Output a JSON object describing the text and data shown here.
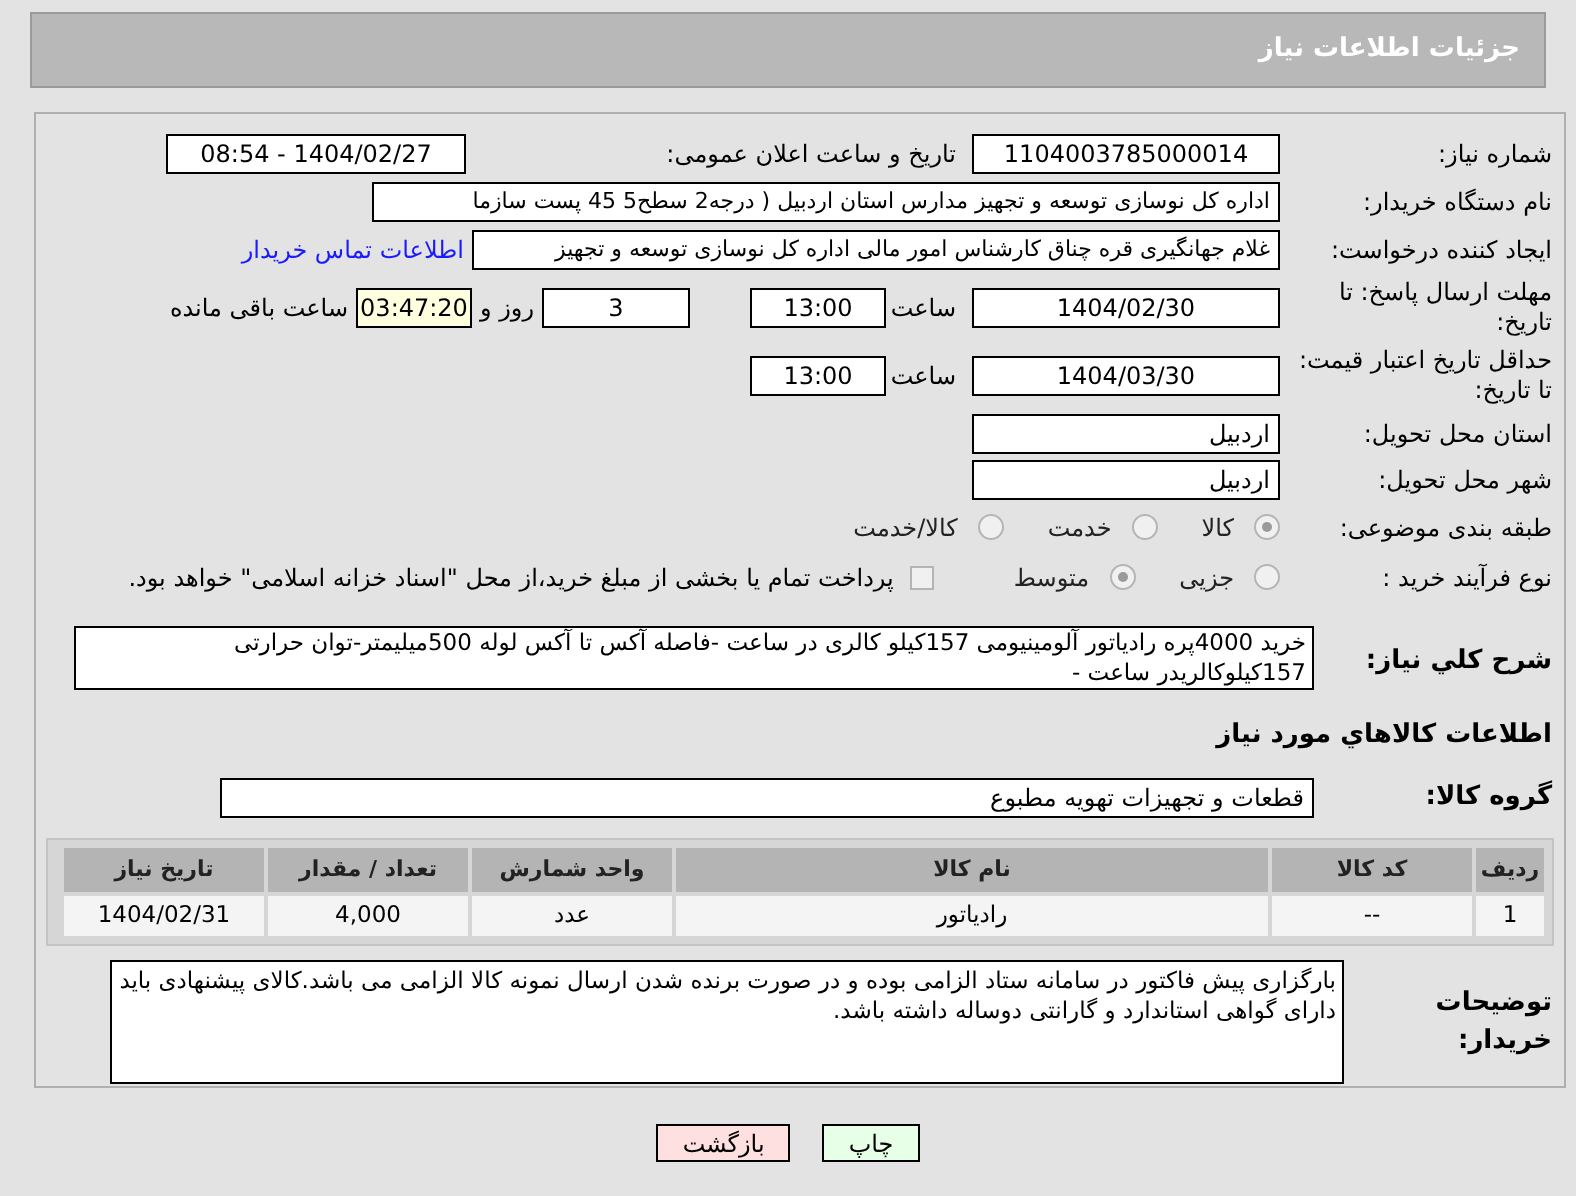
{
  "header": {
    "title": "جزئیات اطلاعات نیاز"
  },
  "need_number": {
    "label": "شماره نیاز:",
    "value": "1104003785000014"
  },
  "announce": {
    "label": "تاریخ و ساعت اعلان عمومی:",
    "value": "1404/02/27 - 08:54"
  },
  "buyer": {
    "label": "نام دستگاه خریدار:",
    "value": "اداره کل نوسازی   توسعه و تجهیز مدارس استان اردبیل ( درجه2  سطح5  45 پست سازما"
  },
  "creator": {
    "label": "ایجاد کننده درخواست:",
    "value": "غلام جهانگیری قره چناق کارشناس امور مالی اداره کل نوسازی   توسعه و تجهیز",
    "link": "اطلاعات تماس خریدار"
  },
  "deadline": {
    "label": "مهلت ارسال پاسخ: تا تاریخ:",
    "date": "1404/02/30",
    "time_label": "ساعت",
    "time": "13:00",
    "days": "3",
    "days_label": "روز و",
    "remaining": "03:47:20",
    "remaining_label": "ساعت باقی مانده"
  },
  "validity": {
    "label": "حداقل تاریخ اعتبار قیمت: تا تاریخ:",
    "date": "1404/03/30",
    "time_label": "ساعت",
    "time": "13:00"
  },
  "province": {
    "label": "استان محل تحویل:",
    "value": "اردبیل"
  },
  "city": {
    "label": "شهر محل تحویل:",
    "value": "اردبیل"
  },
  "category": {
    "label": "طبقه بندی موضوعی:",
    "options": [
      {
        "label": "کالا",
        "selected": true
      },
      {
        "label": "خدمت",
        "selected": false
      },
      {
        "label": "کالا/خدمت",
        "selected": false
      }
    ]
  },
  "process": {
    "label": "نوع فرآیند خرید :",
    "options": [
      {
        "label": "جزیی",
        "selected": false
      },
      {
        "label": "متوسط",
        "selected": true
      }
    ],
    "checkbox": {
      "checked": false,
      "label": "پرداخت تمام یا بخشی از مبلغ خرید،از محل \"اسناد خزانه اسلامی\" خواهد بود."
    }
  },
  "description": {
    "label": "شرح کلي نياز:",
    "value": "خرید 4000پره رادیاتور آلومینیومی 157کیلو کالری در ساعت -فاصله آکس تا آکس لوله 500میلیمتر-توان حرارتی 157کیلوکالریدر ساعت -"
  },
  "goods_heading": "اطلاعات کالاهاي مورد نياز",
  "group": {
    "label": "گروه کالا:",
    "value": "قطعات و تجهیزات تهویه مطبوع"
  },
  "table": {
    "columns": [
      "ردیف",
      "کد کالا",
      "نام کالا",
      "واحد شمارش",
      "تعداد / مقدار",
      "تاریخ نیاز"
    ],
    "rows": [
      [
        "1",
        "--",
        "رادیاتور",
        "عدد",
        "4,000",
        "1404/02/31"
      ]
    ]
  },
  "notes": {
    "label": "توضیحات خریدار:",
    "value": "بارگزاری پیش فاکتور در سامانه ستاد الزامی بوده و در صورت برنده شدن ارسال نمونه کالا الزامی می باشد.کالای پیشنهادی باید دارای گواهی استاندارد و گارانتی دوساله داشته باشد."
  },
  "buttons": [
    {
      "label": "چاپ",
      "kind": "print"
    },
    {
      "label": "بازگشت",
      "kind": "back"
    }
  ]
}
